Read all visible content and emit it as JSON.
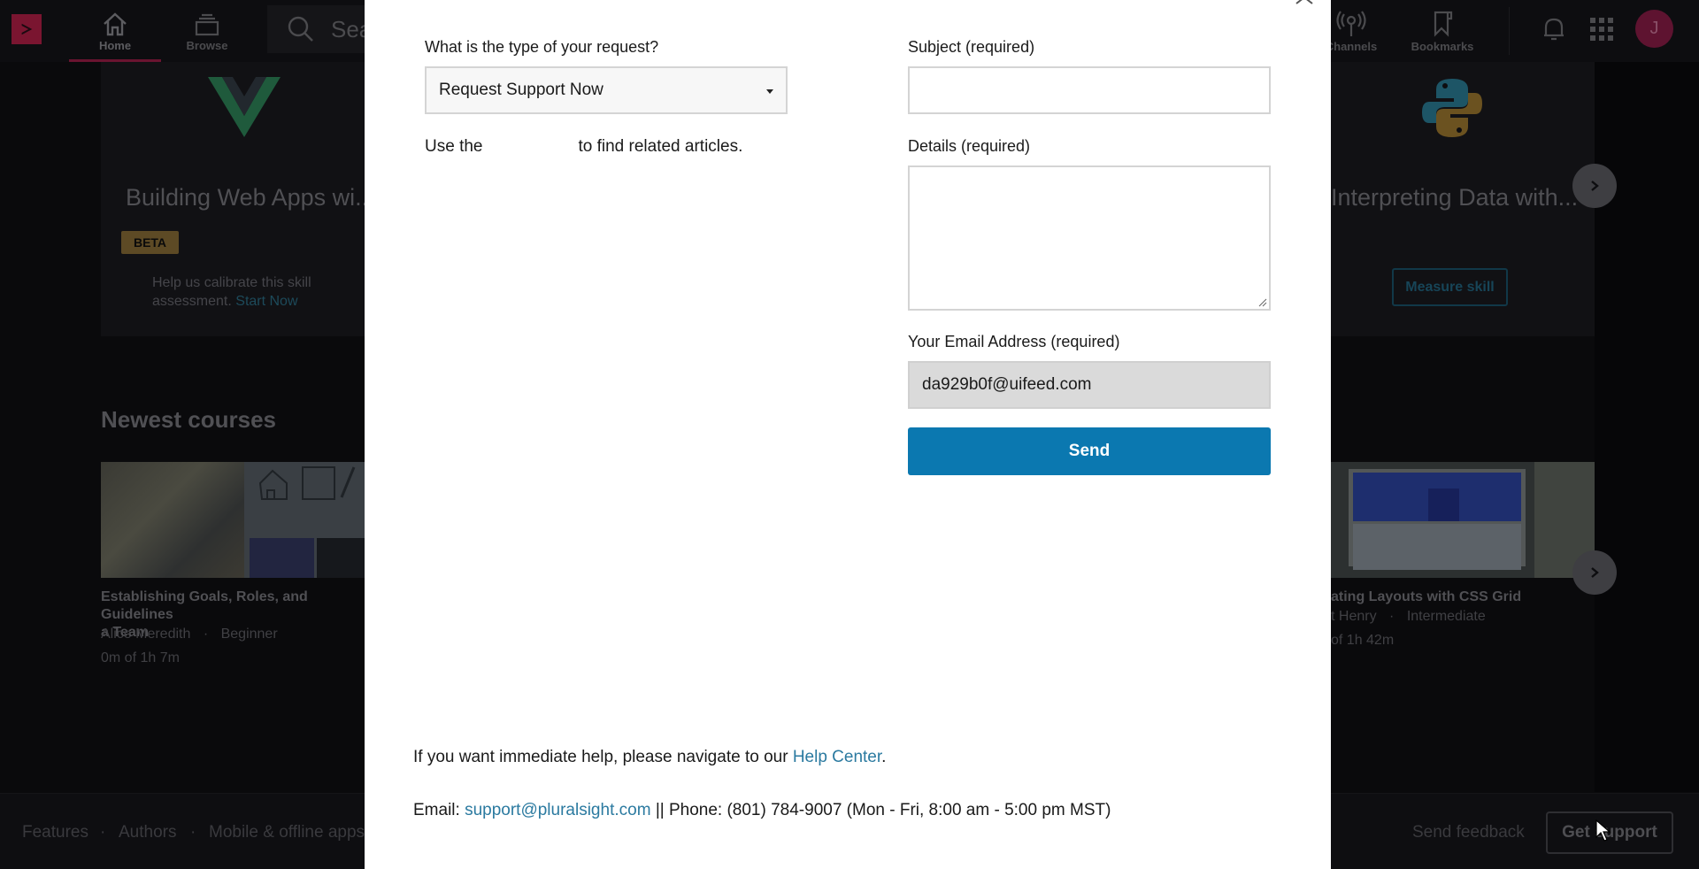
{
  "nav": {
    "home_label": "Home",
    "browse_label": "Browse",
    "search_placeholder": "Sea",
    "channels_label": "Channels",
    "bookmarks_label": "Bookmarks",
    "avatar_initial": "J"
  },
  "skills": [
    {
      "title": "Building Web Apps wi...",
      "badge": "BETA",
      "help_text": "Help us calibrate this skill assessment.",
      "help_link": "Start Now"
    },
    {
      "title": "Interpreting Data with...",
      "action": "Measure skill"
    }
  ],
  "newest_courses": {
    "title": "Newest courses",
    "items": [
      {
        "title": "Establishing Goals, Roles, and Guidelines for a Team",
        "title_visible": "Establishing Goals, Roles, and Guidelines",
        "title_line2": "a Team",
        "author": "Alice Meredith",
        "level": "Beginner",
        "progress": "0m of 1h 7m"
      },
      {
        "title_visible": "ating Layouts with CSS Grid",
        "author_visible": "t Henry",
        "level": "Intermediate",
        "progress_visible": "of 1h 42m"
      }
    ]
  },
  "footer": {
    "links": [
      "Features",
      "Authors",
      "Mobile & offline apps"
    ],
    "separator": "·",
    "send_feedback": "Send feedback",
    "get_support": "Get support"
  },
  "modal": {
    "request_type_label": "What is the type of your request?",
    "request_type_value": "Request Support Now",
    "use_text_before": "Use the",
    "use_text_after": "to find related articles.",
    "subject_label": "Subject (required)",
    "subject_value": "",
    "details_label": "Details (required)",
    "details_value": "",
    "email_label": "Your Email Address (required)",
    "email_value": "da929b0f@uifeed.com",
    "send_label": "Send",
    "immediate_help_text": "If you want immediate help, please navigate to our",
    "help_center_link": "Help Center",
    "period": ".",
    "email_prefix": "Email:",
    "support_email": "support@pluralsight.com",
    "phone_text": "|| Phone: (801) 784-9007 (Mon - Fri, 8:00 am - 5:00 pm MST)"
  },
  "colors": {
    "brand": "#f15b2a",
    "send_button": "#0b78b0",
    "link": "#2b7aa0",
    "avatar": "#5e1330"
  }
}
